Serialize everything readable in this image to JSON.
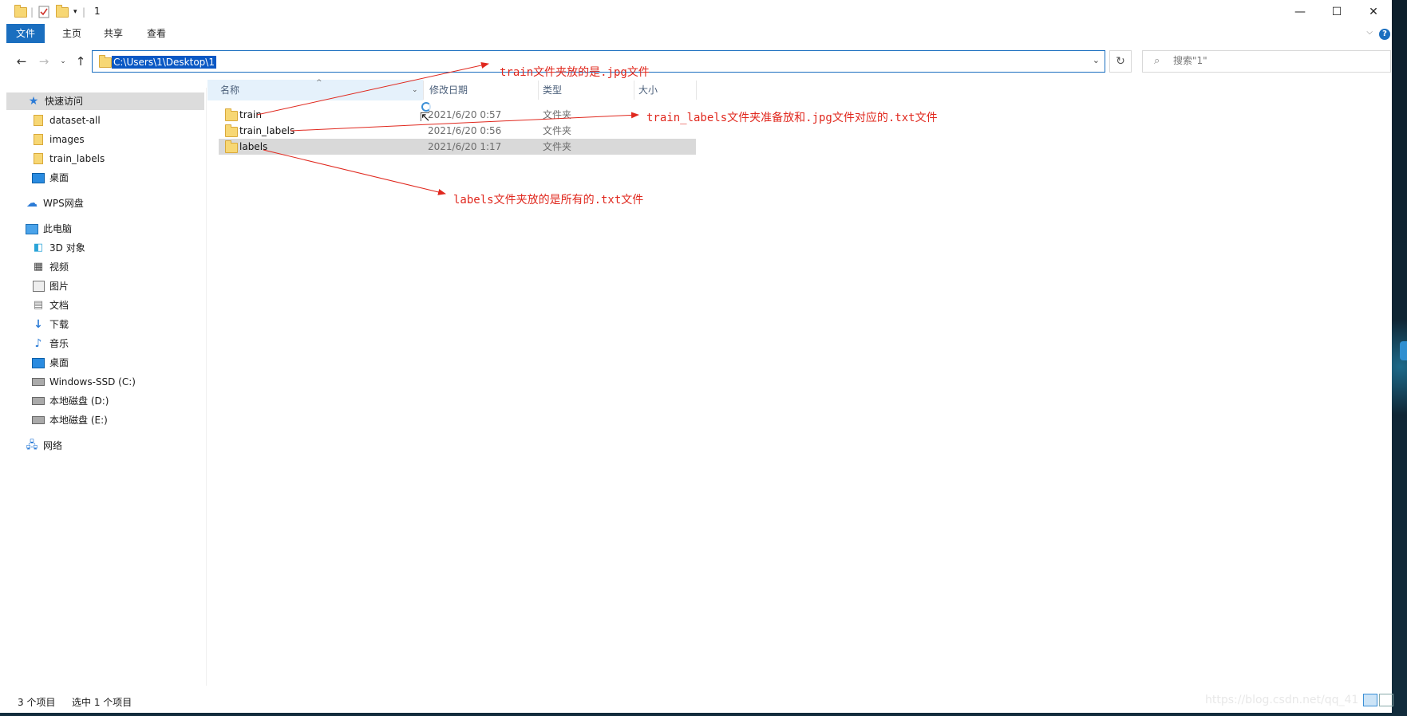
{
  "window": {
    "title": "1",
    "minimize": "—",
    "maximize": "☐",
    "close": "✕"
  },
  "ribbon": {
    "tabs": [
      "文件",
      "主页",
      "共享",
      "查看"
    ],
    "help": "?"
  },
  "address": {
    "path": "C:\\Users\\1\\Desktop\\1"
  },
  "search": {
    "placeholder": "搜索\"1\""
  },
  "sidebar": {
    "items": [
      {
        "label": "快速访问",
        "icon": "star-icon"
      },
      {
        "label": "dataset-all",
        "icon": "folder-icon"
      },
      {
        "label": "images",
        "icon": "folder-icon"
      },
      {
        "label": "train_labels",
        "icon": "folder-icon"
      },
      {
        "label": "桌面",
        "icon": "desktop-icon"
      },
      {
        "label": "WPS网盘",
        "icon": "cloud-icon"
      },
      {
        "label": "此电脑",
        "icon": "computer-icon"
      },
      {
        "label": "3D 对象",
        "icon": "cube-icon"
      },
      {
        "label": "视频",
        "icon": "video-icon"
      },
      {
        "label": "图片",
        "icon": "picture-icon"
      },
      {
        "label": "文档",
        "icon": "document-icon"
      },
      {
        "label": "下载",
        "icon": "download-icon"
      },
      {
        "label": "音乐",
        "icon": "music-icon"
      },
      {
        "label": "桌面",
        "icon": "desktop-icon"
      },
      {
        "label": "Windows-SSD (C:)",
        "icon": "drive-icon"
      },
      {
        "label": "本地磁盘 (D:)",
        "icon": "drive-icon"
      },
      {
        "label": "本地磁盘 (E:)",
        "icon": "drive-icon"
      },
      {
        "label": "网络",
        "icon": "network-icon"
      }
    ]
  },
  "columns": {
    "name": "名称",
    "date": "修改日期",
    "type": "类型",
    "size": "大小"
  },
  "files": [
    {
      "name": "train",
      "date": "2021/6/20 0:57",
      "type": "文件夹"
    },
    {
      "name": "train_labels",
      "date": "2021/6/20 0:56",
      "type": "文件夹"
    },
    {
      "name": "labels",
      "date": "2021/6/20 1:17",
      "type": "文件夹"
    }
  ],
  "status": {
    "count": "3 个项目",
    "selected": "选中 1 个项目"
  },
  "annotations": {
    "train": "train文件夹放的是.jpg文件",
    "train_labels": "train_labels文件夹准备放和.jpg文件对应的.txt文件",
    "labels": "labels文件夹放的是所有的.txt文件"
  },
  "watermark": "https://blog.csdn.net/qq_41"
}
